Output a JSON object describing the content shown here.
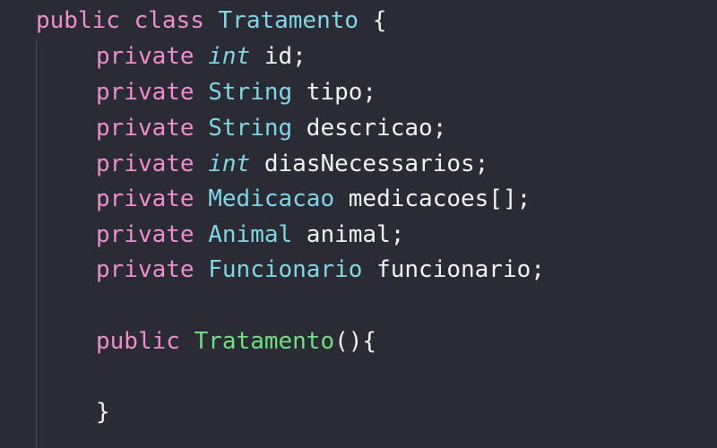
{
  "code": {
    "class_decl": {
      "kw_public": "public",
      "kw_class": "class",
      "class_name": "Tratamento",
      "open_brace": " {"
    },
    "fields": [
      {
        "modifier": "private",
        "type": "int",
        "name": " id;"
      },
      {
        "modifier": "private",
        "type": "String",
        "name": " tipo;"
      },
      {
        "modifier": "private",
        "type": "String",
        "name": " descricao;"
      },
      {
        "modifier": "private",
        "type": "int",
        "name": " diasNecessarios;"
      },
      {
        "modifier": "private",
        "type": "Medicacao",
        "name": " medicacoes[];"
      },
      {
        "modifier": "private",
        "type": "Animal",
        "name": " animal;"
      },
      {
        "modifier": "private",
        "type": "Funcionario",
        "name": " funcionario;"
      }
    ],
    "constructor": {
      "modifier": "public",
      "name": "Tratamento",
      "signature": "(){",
      "close_brace": "}"
    }
  },
  "colors": {
    "background": "#2a2b35",
    "keyword": "#f08cd0",
    "type": "#7fd6e6",
    "identifier": "#f2f2f2",
    "constructor": "#6ee07c"
  }
}
